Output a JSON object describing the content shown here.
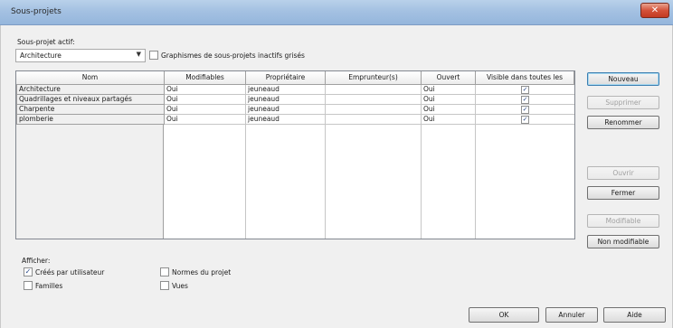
{
  "window": {
    "title": "Sous-projets",
    "close_glyph": "✕"
  },
  "active_subproject": {
    "label": "Sous-projet actif:",
    "value": "Architecture",
    "gray_checkbox_label": "Graphismes de sous-projets inactifs grisés",
    "gray_checked": false
  },
  "table": {
    "headers": [
      "Nom",
      "Modifiables",
      "Propriétaire",
      "Emprunteur(s)",
      "Ouvert",
      "Visible dans toutes les"
    ],
    "rows": [
      {
        "name": "Architecture",
        "editable": "Oui",
        "owner": "jeuneaud",
        "borrowers": "",
        "open": "Oui",
        "visible": true
      },
      {
        "name": "Quadrillages et niveaux partagés",
        "editable": "Oui",
        "owner": "jeuneaud",
        "borrowers": "",
        "open": "Oui",
        "visible": true
      },
      {
        "name": "Charpente",
        "editable": "Oui",
        "owner": "jeuneaud",
        "borrowers": "",
        "open": "Oui",
        "visible": true
      },
      {
        "name": "plomberie",
        "editable": "Oui",
        "owner": "jeuneaud",
        "borrowers": "",
        "open": "Oui",
        "visible": true
      }
    ]
  },
  "side_buttons": {
    "nouveau": "Nouveau",
    "supprimer": "Supprimer",
    "renommer": "Renommer",
    "ouvrir": "Ouvrir",
    "fermer": "Fermer",
    "modifiable": "Modifiable",
    "non_modifiable": "Non modifiable"
  },
  "show": {
    "label": "Afficher:",
    "created_by_user": "Créés par utilisateur",
    "families": "Familles",
    "project_standards": "Normes du projet",
    "views": "Vues",
    "created_by_user_checked": true
  },
  "footer": {
    "ok": "OK",
    "cancel": "Annuler",
    "help": "Aide"
  },
  "check_glyph": "✓"
}
